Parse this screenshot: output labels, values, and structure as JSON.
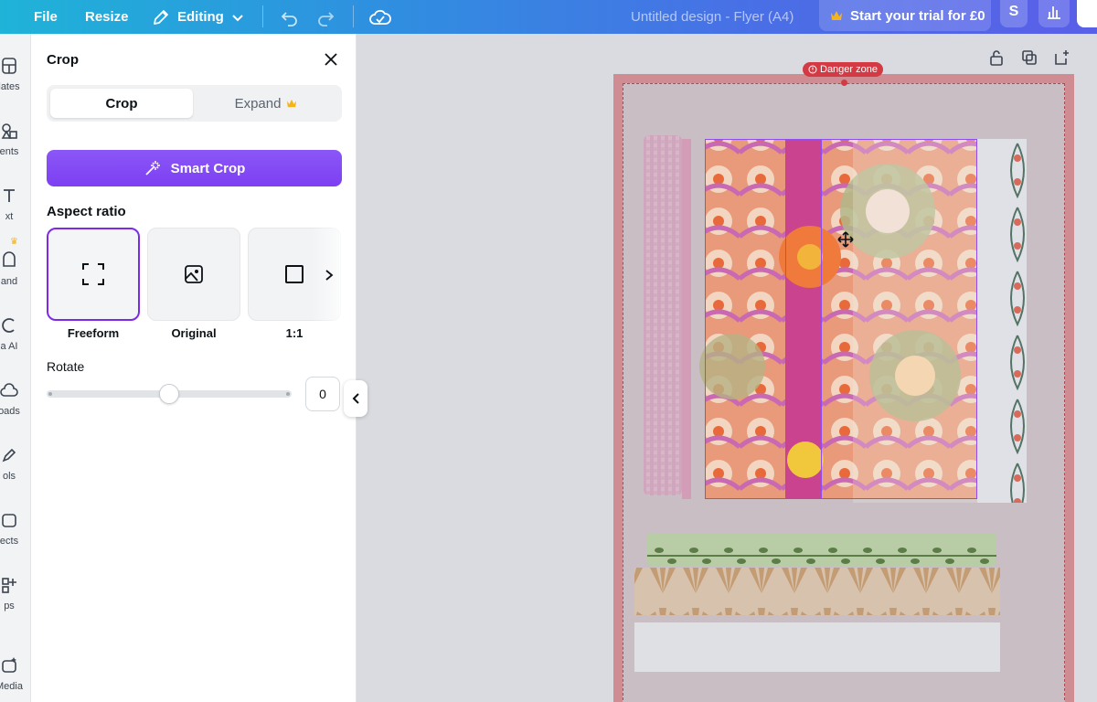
{
  "topbar": {
    "file": "File",
    "resize": "Resize",
    "editing": "Editing",
    "title": "Untitled design - Flyer (A4)",
    "trial": "Start your trial for £0",
    "avatar_initial": "S"
  },
  "rail": {
    "items": [
      "lates",
      "ents",
      "xt",
      "and",
      "a AI",
      "oads",
      "ols",
      "ects",
      "ps",
      "Media"
    ]
  },
  "panel": {
    "title": "Crop",
    "tabs": [
      {
        "label": "Crop",
        "active": true
      },
      {
        "label": "Expand",
        "active": false
      }
    ],
    "smart_crop": "Smart Crop",
    "aspect_ratio_label": "Aspect ratio",
    "ratios": [
      {
        "label": "Freeform",
        "icon": "freeform-icon",
        "selected": true
      },
      {
        "label": "Original",
        "icon": "image-icon",
        "selected": false
      },
      {
        "label": "1:1",
        "icon": "square-icon",
        "selected": false
      }
    ],
    "rotate_label": "Rotate",
    "rotate_value": "0",
    "rotate_fraction": 0.5
  },
  "canvas": {
    "danger_zone": "Danger zone"
  },
  "colors": {
    "accent_purple": "#7d2ae8",
    "danger": "#d43a43",
    "page_border": "#cf8c92"
  }
}
